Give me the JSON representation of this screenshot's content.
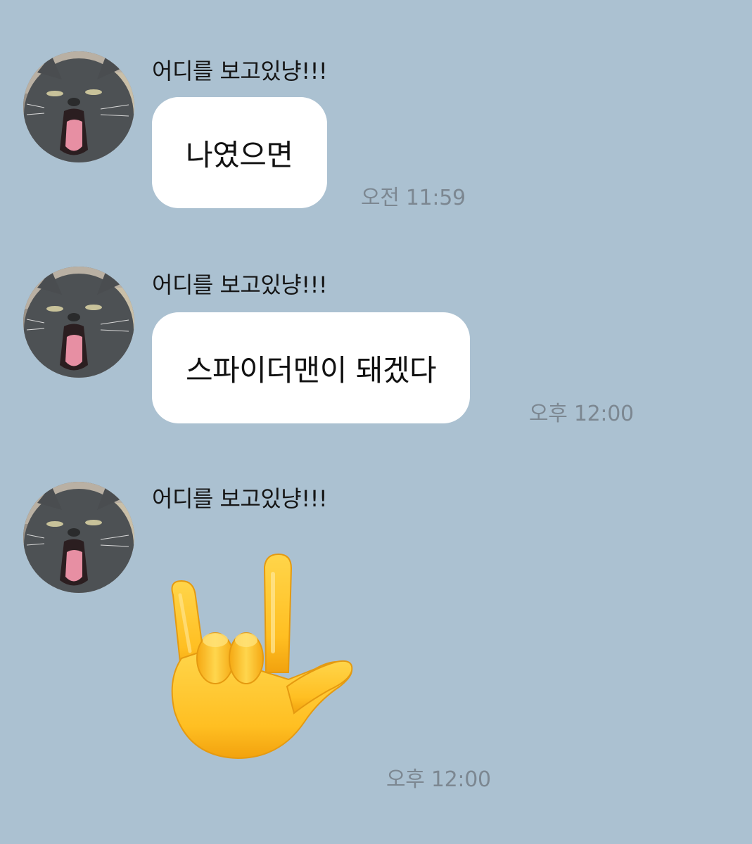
{
  "messages": [
    {
      "sender": "어디를 보고있냥!!!",
      "text": "나였으면",
      "time": "오전 11:59",
      "avatar_icon": "cat-yawning-avatar"
    },
    {
      "sender": "어디를 보고있냥!!!",
      "text": "스파이더맨이 돼겠다",
      "time": "오후 12:00",
      "avatar_icon": "cat-yawning-avatar"
    },
    {
      "sender": "어디를 보고있냥!!!",
      "emoji": "love-you-gesture-emoji",
      "time": "오후 12:00",
      "avatar_icon": "cat-yawning-avatar"
    }
  ],
  "colors": {
    "background": "#abc1d1",
    "bubble": "#ffffff",
    "timestamp": "#7c8791",
    "emoji_yellow": "#ffcc33"
  }
}
